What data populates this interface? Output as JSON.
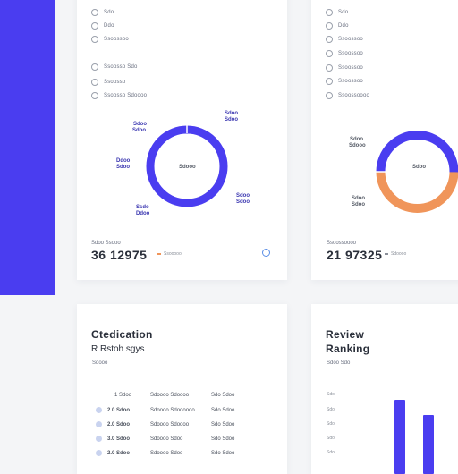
{
  "colors": {
    "accent": "#4a3df0",
    "secondary": "#f0955a",
    "background": "#f4f5f7",
    "card": "#ffffff"
  },
  "top_left": {
    "list": [
      {
        "label": "Sdo"
      },
      {
        "label": "Ddo"
      },
      {
        "label": "Ssoossoo"
      },
      {
        "label": "Ssoosso   Sdo"
      },
      {
        "label": "Ssoosso"
      },
      {
        "label": "Ssoosso  Sdoooo"
      }
    ],
    "donut_center": "Sdooo",
    "labels": {
      "top_left": [
        "Sdoo",
        "Sdoo"
      ],
      "top_right": [
        "Sdoo",
        "Sdoo"
      ],
      "mid_left": [
        "Ddoo",
        "Sdoo"
      ],
      "mid_right": [
        "Sdoo",
        "Sdoo"
      ],
      "bottom_left": [
        "Ssdo",
        "Ddoo"
      ]
    },
    "stat_caption": "Sdoo Ssooo",
    "stat_value": "36 12975",
    "legend_label": "Ssooooo"
  },
  "top_right": {
    "list": [
      {
        "label": "Sdo"
      },
      {
        "label": "Ddo"
      },
      {
        "label": "Ssoossoo"
      },
      {
        "label": "Ssoossoo"
      },
      {
        "label": "Ssoossoo"
      },
      {
        "label": "Ssoossoo"
      },
      {
        "label": "Ssoossoooo"
      }
    ],
    "donut_center": "Sdoo",
    "labels": {
      "left": [
        "Sdoo",
        "Sdooo"
      ],
      "bottom_left": [
        "Sdoo",
        "Sdoo"
      ]
    },
    "stat_caption": "Ssoossoooo",
    "stat_value": "21 97325",
    "legend_label": "Sdoooo"
  },
  "bottom_left": {
    "title": "Ctedication",
    "subtitle": "R Rstoh sgys",
    "caption": "Sdooo",
    "rows": [
      {
        "num": "1 Sdoo",
        "desc": "Sdoooo Sdoooo",
        "val": "Sdo  Sdoo"
      },
      {
        "num": "2.0  Sdoo",
        "desc": "Sdoooo Sdoooooo",
        "val": "Sdo  Sdoo"
      },
      {
        "num": "2.0  Sdoo",
        "desc": "Sdoooo Sdoooo",
        "val": "Sdo  Sdoo"
      },
      {
        "num": "3.0  Sdoo",
        "desc": "Sdoooo Sdoo",
        "val": "Sdo  Sdoo"
      },
      {
        "num": "2.0  Sdoo",
        "desc": "Sdoooo Sdoo",
        "val": "Sdo  Sdoo"
      }
    ]
  },
  "bottom_right": {
    "title": "Review",
    "subtitle": "Ranking",
    "caption": "Sdoo Sdo",
    "ticks": [
      "Sdo",
      "Sdo",
      "Sdo",
      "Sdo",
      "Sdo"
    ]
  }
}
